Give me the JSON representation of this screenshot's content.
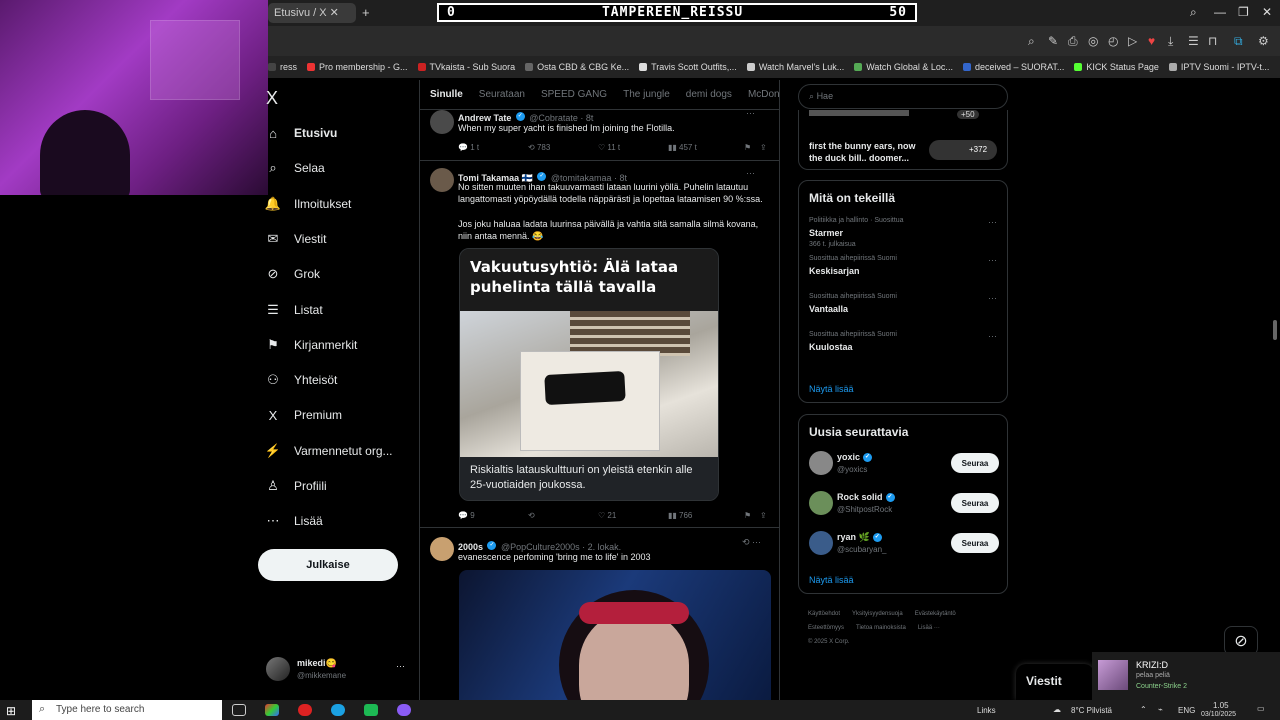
{
  "browser": {
    "tab_title": "Etusivu / X",
    "new_tab": "+",
    "scoreboard": {
      "left": "0",
      "title": "TAMPEREEN_REISSU",
      "right": "50"
    },
    "bookmarks": [
      {
        "label": "ress",
        "color": "#444"
      },
      {
        "label": "Pro membership - G...",
        "color": "#e33"
      },
      {
        "label": "TVkaista - Sub Suora",
        "color": "#c22"
      },
      {
        "label": "Osta CBD & CBG Ke...",
        "color": "#666"
      },
      {
        "label": "Travis Scott Outfits,...",
        "color": "#ddd"
      },
      {
        "label": "Watch Marvel's Luk...",
        "color": "#ccc"
      },
      {
        "label": "Watch Global & Loc...",
        "color": "#5a5"
      },
      {
        "label": "deceived – SUORAT...",
        "color": "#36c"
      },
      {
        "label": "KICK Status Page",
        "color": "#5f3"
      },
      {
        "label": "IPTV Suomi - IPTV-t...",
        "color": "#aaa"
      }
    ]
  },
  "sidebar": {
    "logo": "X",
    "items": [
      {
        "label": "Etusivu",
        "icon": "⌂",
        "bold": true
      },
      {
        "label": "Selaa",
        "icon": "⌕"
      },
      {
        "label": "Ilmoitukset",
        "icon": "🔔"
      },
      {
        "label": "Viestit",
        "icon": "✉"
      },
      {
        "label": "Grok",
        "icon": "⊘"
      },
      {
        "label": "Listat",
        "icon": "☰"
      },
      {
        "label": "Kirjanmerkit",
        "icon": "⚑"
      },
      {
        "label": "Yhteisöt",
        "icon": "⚇"
      },
      {
        "label": "Premium",
        "icon": "X"
      },
      {
        "label": "Varmennetut org...",
        "icon": "⚡"
      },
      {
        "label": "Profiili",
        "icon": "♙"
      },
      {
        "label": "Lisää",
        "icon": "⋯"
      }
    ],
    "post_button": "Julkaise",
    "account": {
      "name": "mikedi😋",
      "handle": "@mikkemane",
      "more": "···"
    }
  },
  "feed": {
    "tabs": [
      "Sinulle",
      "Seurataan",
      "SPEED GANG",
      "The jungle",
      "demi dogs",
      "McDonal"
    ],
    "tweets": [
      {
        "name": "Andrew Tate",
        "handle": "@Cobratate · 8t",
        "text": "When my super yacht is finished Im joining the Flotilla.",
        "replies": "1 t",
        "retweets": "783",
        "likes": "11 t",
        "views": "457 t"
      },
      {
        "name": "Tomi Takamaa 🇫🇮",
        "handle": "@tomitakamaa · 8t",
        "text1": "No sitten muuten ihan takuuvarmasti lataan luurini yöllä. Puhelin latautuu langattomasti yöpöydällä todella näppärästi ja lopettaa lataamisen 90 %:ssa.",
        "text2": "Jos joku haluaa ladata luurinsa päivällä ja vahtia sitä samalla silmä kovana, niin antaa mennä. 😂",
        "card_headline": "Vakuutusyhtiö: Älä lataa puhelinta tällä tavalla",
        "card_caption": "Riskialtis latauskulttuuri on yleistä etenkin alle 25-vuotiaiden joukossa.",
        "replies": "9",
        "retweets": "",
        "likes": "21",
        "views": "766"
      },
      {
        "name": "2000s",
        "handle": "@PopCulture2000s · 2. lokak.",
        "text": "evanescence perfoming 'bring me to life' in 2003"
      }
    ]
  },
  "right": {
    "search_placeholder": "Hae",
    "top_item": {
      "text": "first the bunny ears, now the duck bill.. doomer...",
      "count": "+372",
      "count_top": "+50"
    },
    "trends_title": "Mitä on tekeillä",
    "trends": [
      {
        "category": "Politiikka ja hallinto · Suosittua",
        "name": "Starmer",
        "count": "366 t. julkaisua"
      },
      {
        "category": "Suosittua aihepiirissä Suomi",
        "name": "Keskisarjan",
        "count": ""
      },
      {
        "category": "Suosittua aihepiirissä Suomi",
        "name": "Vantaalla",
        "count": ""
      },
      {
        "category": "Suosittua aihepiirissä Suomi",
        "name": "Kuulostaa",
        "count": ""
      }
    ],
    "show_more": "Näytä lisää",
    "follow_title": "Uusia seurattavia",
    "follows": [
      {
        "name": "yoxic",
        "handle": "@yoxics",
        "button": "Seuraa",
        "color": "#888"
      },
      {
        "name": "Rock solid",
        "handle": "@ShitpostRock",
        "button": "Seuraa",
        "color": "#6b8f5a"
      },
      {
        "name": "ryan 🌿",
        "handle": "@scubaryan_",
        "button": "Seuraa",
        "color": "#3a5c8a"
      }
    ],
    "footer": [
      "Käyttöehdot",
      "Yksityisyydensuoja",
      "Evästekäytäntö",
      "Esteettömyys",
      "Tietoa mainoksista",
      "Lisää ···",
      "© 2025 X Corp."
    ]
  },
  "messages_drawer": "Viestit",
  "notification": {
    "title": "KRIZI:D",
    "subtitle": "pelaa peliä",
    "game": "Counter-Strike 2"
  },
  "taskbar": {
    "search_placeholder": "Type here to search",
    "links": "Links",
    "weather": "8°C  Pilvistä",
    "lang": "ENG",
    "time": "1.05",
    "date": "03/10/2025"
  }
}
